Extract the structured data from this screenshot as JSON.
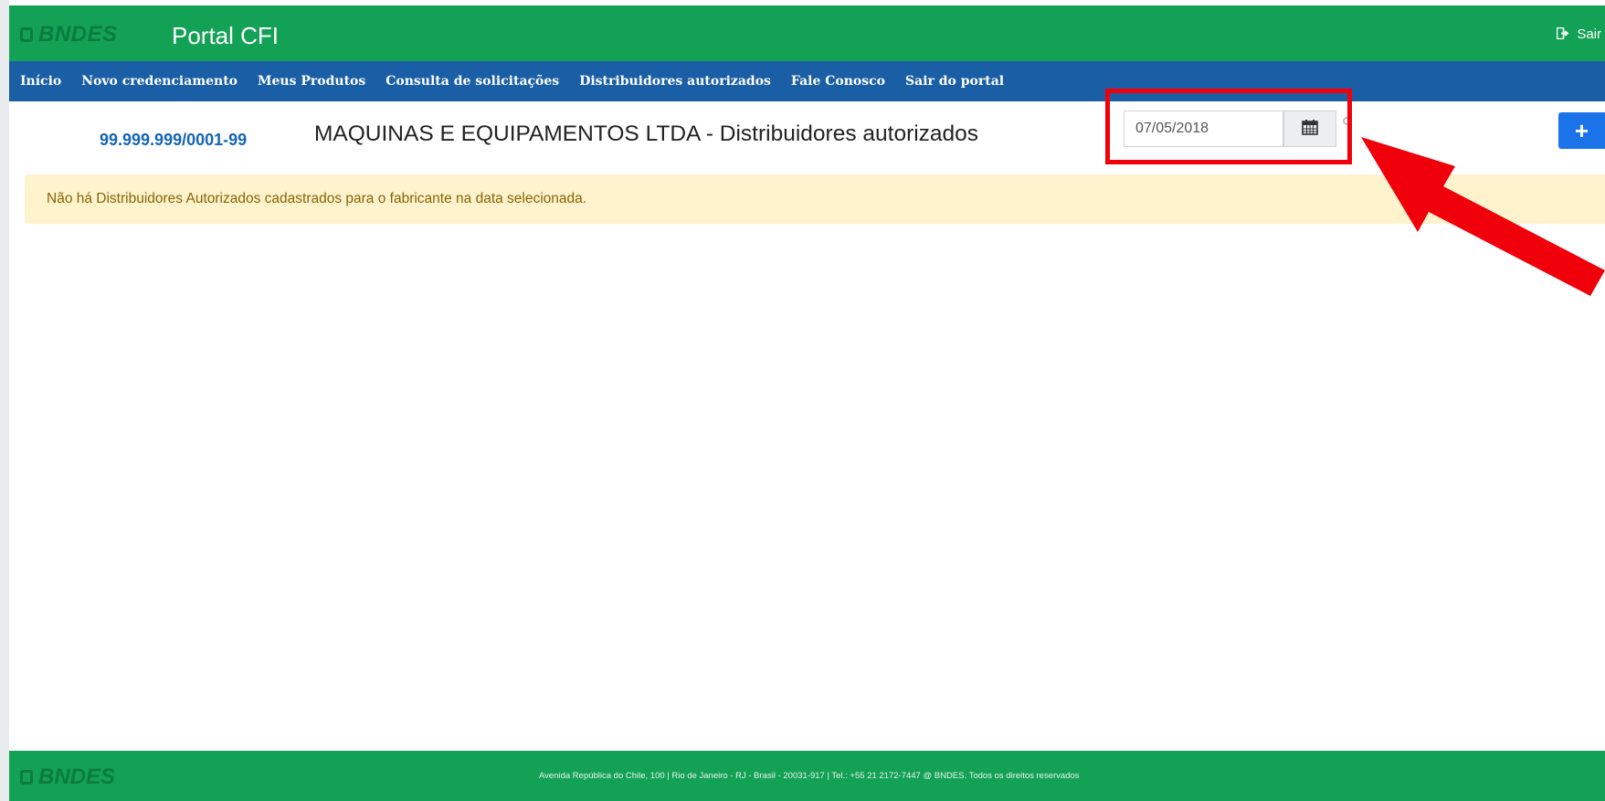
{
  "header": {
    "logo_text": "BNDES",
    "title": "Portal CFI",
    "logout_label": "Sair"
  },
  "nav": {
    "items": [
      {
        "label": "Início"
      },
      {
        "label": "Novo credenciamento"
      },
      {
        "label": "Meus Produtos"
      },
      {
        "label": "Consulta de solicitações"
      },
      {
        "label": "Distribuidores autorizados"
      },
      {
        "label": "Fale Conosco"
      },
      {
        "label": "Sair do portal"
      }
    ]
  },
  "main": {
    "cnpj": "99.999.999/0001-99",
    "title": "MAQUINAS E EQUIPAMENTOS LTDA - Distribuidores autorizados",
    "date_value": "07/05/2018",
    "add_button": "+",
    "alert_text": "Não há Distribuidores Autorizados cadastrados para o fabricante na data selecionada."
  },
  "footer": {
    "logo_text": "BNDES",
    "address": "Avenida República do Chile, 100 | Rio de Janeiro - RJ - Brasil - 20031-917 | Tel.: +55 21 2172-7447 @ BNDES. Todos os direitos reservados"
  },
  "colors": {
    "header_green": "#13a155",
    "nav_blue": "#1a5fa5",
    "highlight_red": "#f0000a",
    "alert_bg": "#fff3cd"
  },
  "icons": {
    "logout": "sign-out-icon",
    "calendar": "calendar-icon",
    "annotation": "red-arrow"
  }
}
